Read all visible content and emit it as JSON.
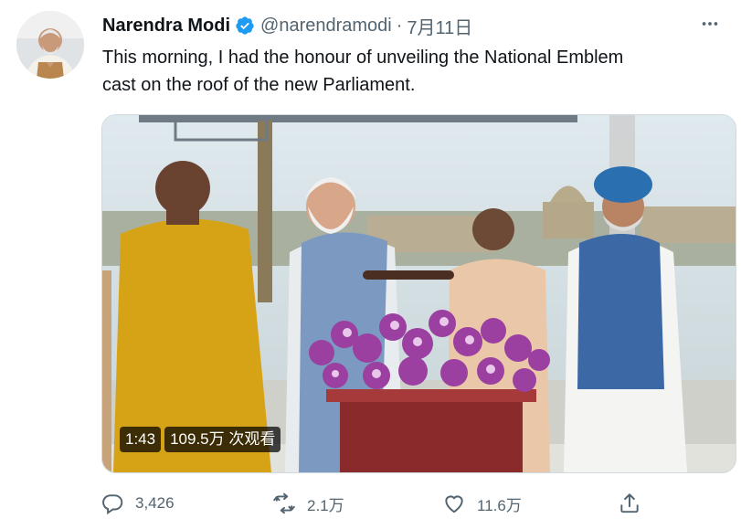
{
  "tweet": {
    "author_name": "Narendra Modi",
    "handle": "@narendramodi",
    "separator": "·",
    "date": "7月11日",
    "text_line1": "This morning, I had the honour of unveiling the National Emblem",
    "text_line2": "cast on the roof of the new Parliament."
  },
  "media": {
    "duration": "1:43",
    "views": "109.5万 次观看"
  },
  "actions": {
    "reply_count": "3,426",
    "retweet_count": "2.1万",
    "like_count": "11.6万"
  },
  "icons": [
    "verified-badge-icon",
    "more-options-icon",
    "reply-icon",
    "retweet-icon",
    "like-icon",
    "share-icon"
  ],
  "colors": {
    "brand_blue": "#1d9bf0",
    "secondary_text": "#536471",
    "primary_text": "#0f1419"
  }
}
